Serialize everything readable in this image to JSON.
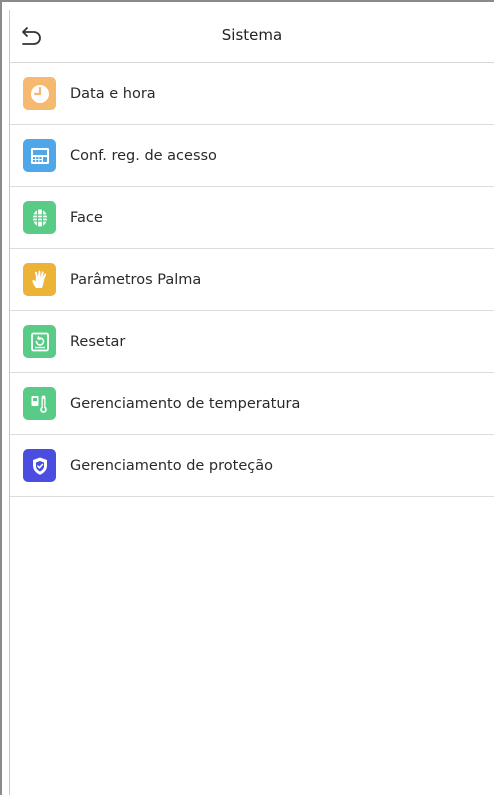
{
  "header": {
    "title": "Sistema"
  },
  "menu": {
    "items": [
      {
        "label": "Data e hora",
        "icon": "clock-icon",
        "color": "#F5B970"
      },
      {
        "label": "Conf. reg. de acesso",
        "icon": "terminal-icon",
        "color": "#4FA6E8"
      },
      {
        "label": "Face",
        "icon": "face-icon",
        "color": "#58CC86"
      },
      {
        "label": "Parâmetros Palma",
        "icon": "palm-icon",
        "color": "#EBB337"
      },
      {
        "label": "Resetar",
        "icon": "reset-icon",
        "color": "#58CC86"
      },
      {
        "label": "Gerenciamento de temperatura",
        "icon": "thermometer-icon",
        "color": "#58CC86"
      },
      {
        "label": "Gerenciamento de proteção",
        "icon": "shield-icon",
        "color": "#4B4CE0"
      }
    ]
  }
}
